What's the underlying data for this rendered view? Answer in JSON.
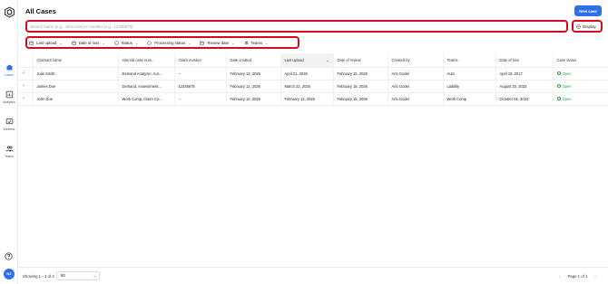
{
  "sidebar": {
    "items": [
      {
        "label": "Cases",
        "icon": "cases-icon"
      },
      {
        "label": "Analytics",
        "icon": "analytics-icon"
      },
      {
        "label": "Wireless",
        "icon": "wireless-icon"
      },
      {
        "label": "Teams",
        "icon": "teams-icon"
      }
    ],
    "avatar_initials": "NZ"
  },
  "header": {
    "title": "All Cases",
    "new_case_label": "New case"
  },
  "search": {
    "placeholder": "Search name (e.g., John Doe) or number (e.g., 12345678)"
  },
  "display_label": "Display",
  "filters": [
    {
      "label": "Last upload"
    },
    {
      "label": "Date of loss"
    },
    {
      "label": "Status"
    },
    {
      "label": "Processing status"
    },
    {
      "label": "Review date"
    },
    {
      "label": "Teams"
    }
  ],
  "table": {
    "columns": [
      "Claimant name",
      "Internal case num...",
      "Claim number",
      "Date created",
      "Last upload",
      "Date of review",
      "Created by",
      "Teams",
      "Date of loss",
      "Case status"
    ],
    "rows": [
      [
        "Julie Smith",
        "Demand Analyzer, Aut...",
        "--",
        "February 12, 2026",
        "April 21, 2026",
        "February 15, 2026",
        "Arlo Godel",
        "Auto",
        "April 19, 2017",
        "Open"
      ],
      [
        "James Doe",
        "Demand, Assessment...",
        "12345678",
        "February 12, 2026",
        "March 22, 2026",
        "February 15, 2026",
        "Arlo Godel",
        "Liability",
        "August 20, 2022",
        "Open"
      ],
      [
        "John Doe",
        "Work Comp, Claim Co...",
        "--",
        "February 12, 2026",
        "February 12, 2026",
        "February 15, 2026",
        "Arlo Godel",
        "Work Comp",
        "October 01, 2022",
        "Open"
      ]
    ]
  },
  "footer": {
    "showing": "Showing 1 - 3 of 3",
    "page_size": "50",
    "page_info": "Page 1 of 1"
  },
  "colors": {
    "accent": "#2f6fed",
    "highlight": "#d40b1e",
    "status_open": "#2e9d4a"
  }
}
